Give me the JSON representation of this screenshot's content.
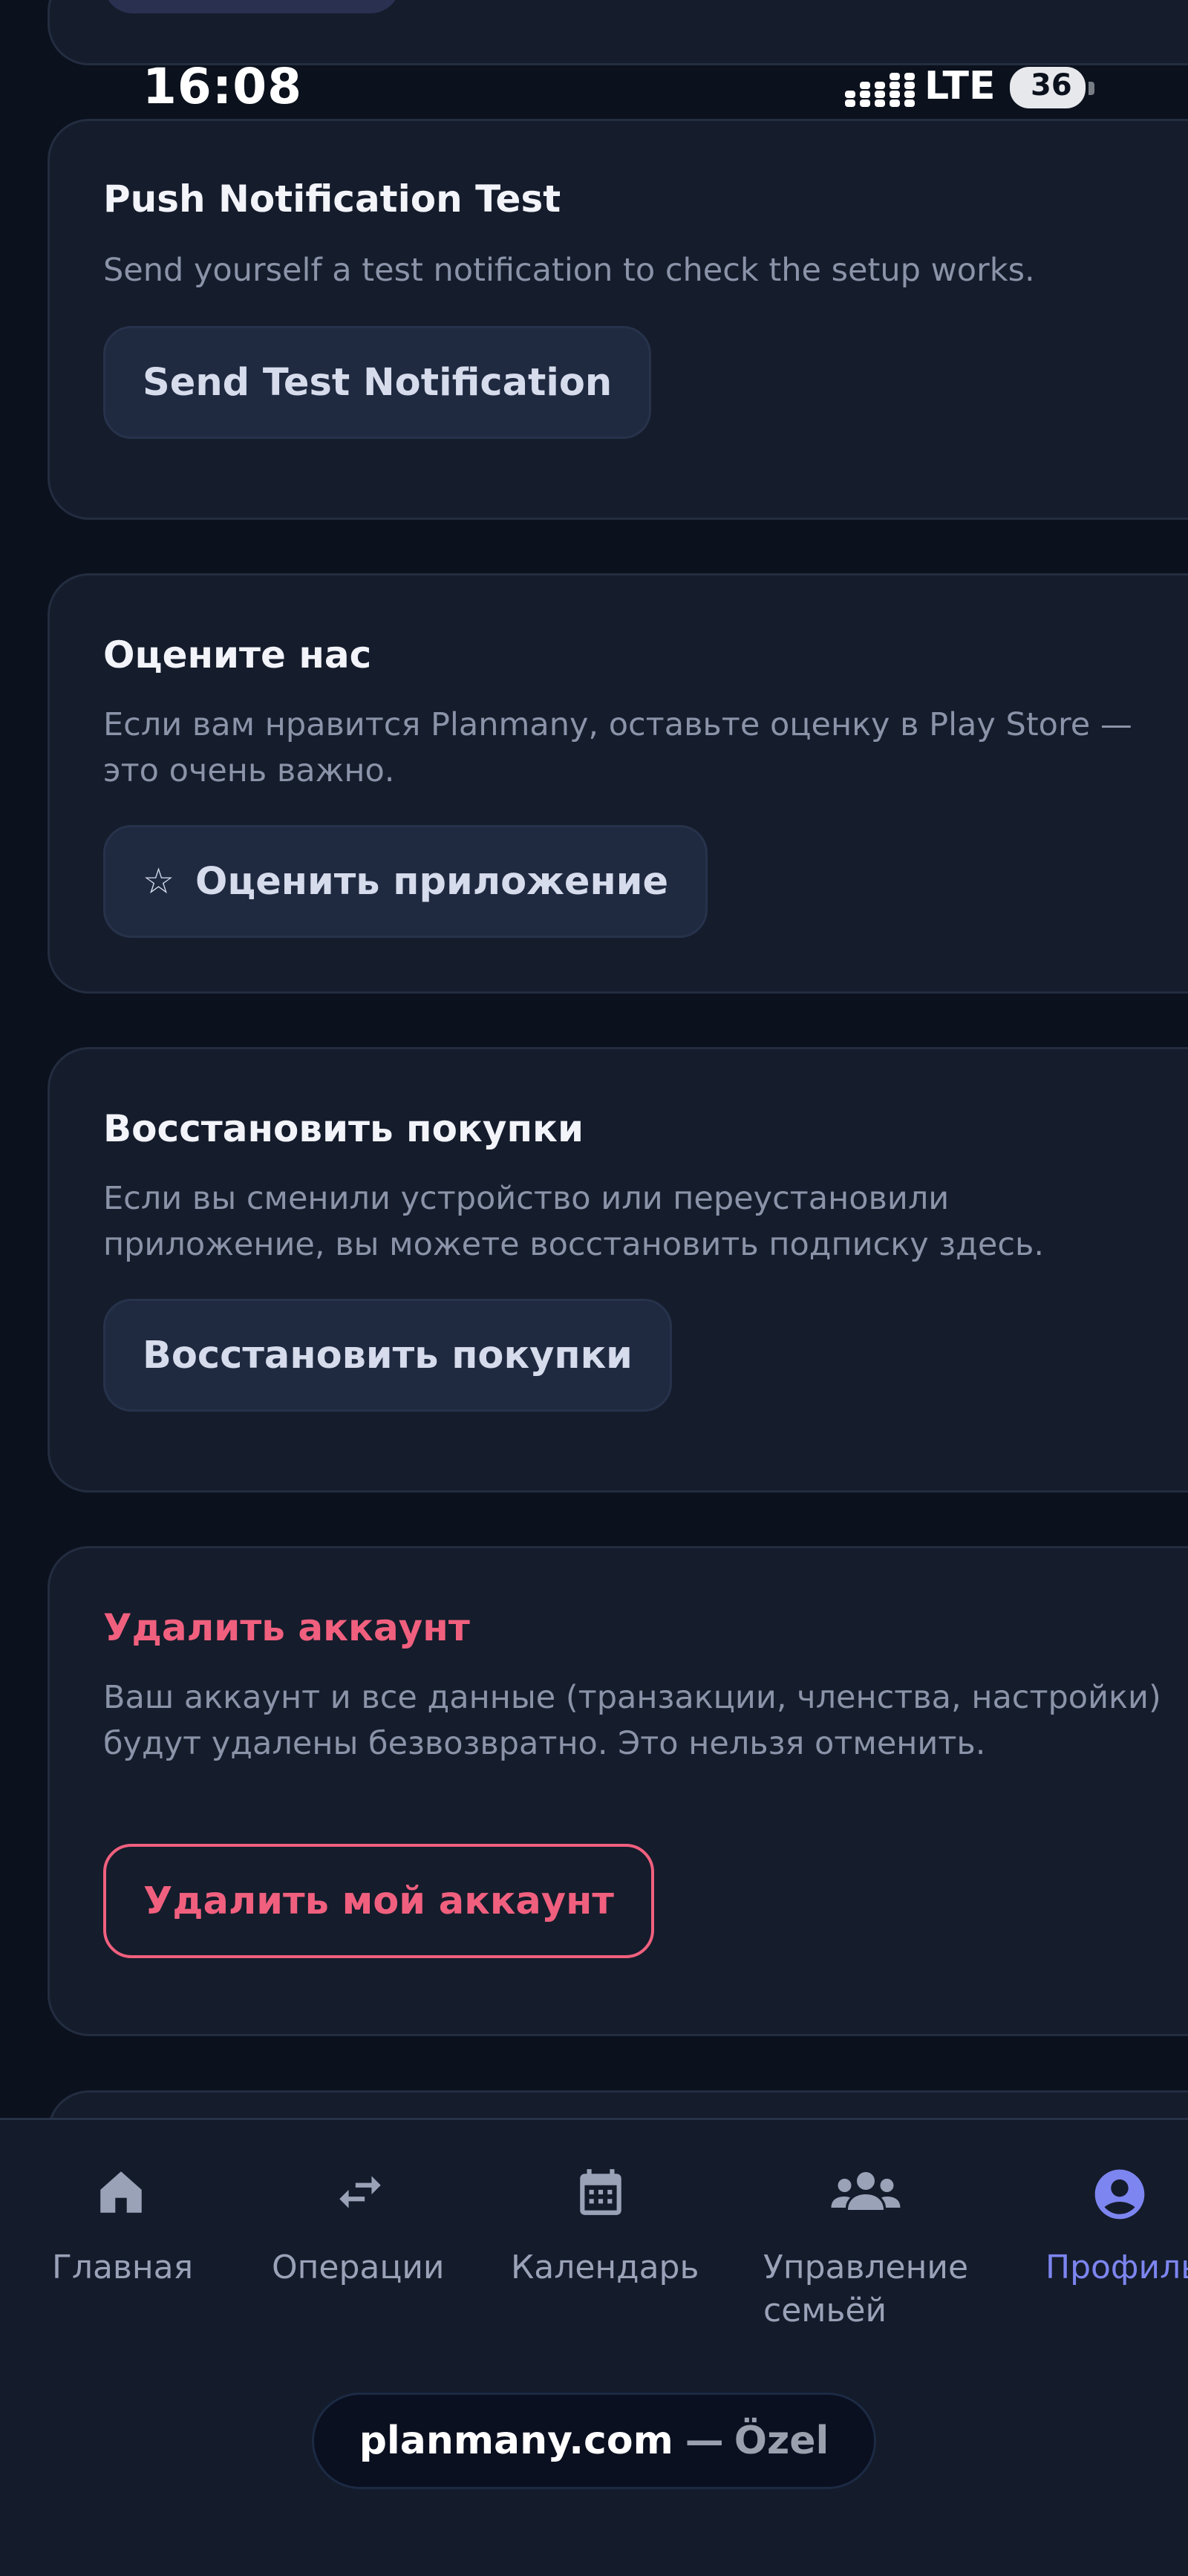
{
  "status_bar": {
    "time": "16:08",
    "network": "LTE",
    "battery": "36"
  },
  "push_test": {
    "title": "Push Notification Test",
    "description": "Send yourself a test notification to check the setup works.",
    "button_label": "Send Test Notification"
  },
  "rate_us": {
    "title": "Оцените нас",
    "description": "Если вам нравится Planmany, оставьте оценку в Play Store — это очень важно.",
    "button_icon": "star-outline-icon",
    "button_label": "Оценить приложение"
  },
  "restore_purchases": {
    "title": "Восстановить покупки",
    "description": "Если вы сменили устройство или переустановили приложение, вы можете восстановить подписку здесь.",
    "button_label": "Восстановить покупки"
  },
  "delete_account": {
    "title": "Удалить аккаунт",
    "description": "Ваш аккаунт и все данные (транзакции, членства, настройки) будут удалены безвозвратно. Это нельзя отменить.",
    "button_label": "Удалить мой аккаунт",
    "accent_color": "#f0607e"
  },
  "bottom_nav": {
    "items": [
      {
        "label": "Главная",
        "icon": "home-icon",
        "active": false
      },
      {
        "label": "Операции",
        "icon": "swap-arrows-icon",
        "active": false
      },
      {
        "label": "Календарь",
        "icon": "calendar-icon",
        "active": false
      },
      {
        "label": "Управление семьёй",
        "icon": "group-icon",
        "active": false
      },
      {
        "label": "Профиль",
        "icon": "profile-icon",
        "active": true
      }
    ],
    "active_color": "#7d85f0"
  },
  "browser": {
    "host": "planmany.com",
    "separator": "—",
    "tag": "Özel"
  }
}
